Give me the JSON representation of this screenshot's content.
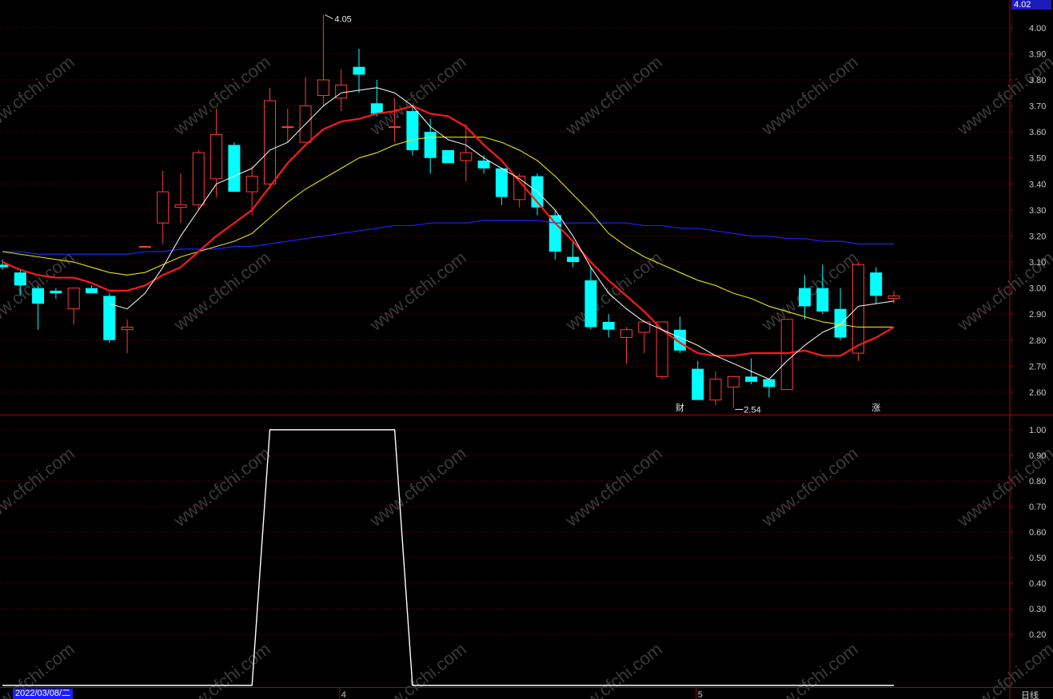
{
  "chart_data": {
    "type": "candlestick",
    "price_panel": {
      "ylim": [
        2.52,
        4.07
      ],
      "ticks": [
        4.0,
        3.9,
        3.8,
        3.7,
        3.6,
        3.5,
        3.4,
        3.3,
        3.2,
        3.1,
        3.0,
        2.9,
        2.8,
        2.7,
        2.6
      ],
      "tick_labels": [
        "4.00",
        "3.90",
        "3.80",
        "3.70",
        "3.60",
        "3.50",
        "3.40",
        "3.30",
        "3.20",
        "3.10",
        "3.00",
        "2.90",
        "2.80",
        "2.70",
        "2.60"
      ],
      "grid": true,
      "high_label": "4.05",
      "low_label": "2.54",
      "markers": [
        "财",
        "涨"
      ],
      "candles": [
        {
          "o": 3.09,
          "h": 3.11,
          "l": 3.07,
          "c": 3.08
        },
        {
          "o": 3.06,
          "h": 3.07,
          "l": 2.97,
          "c": 3.01
        },
        {
          "o": 3.0,
          "h": 3.01,
          "l": 2.84,
          "c": 2.94
        },
        {
          "o": 2.99,
          "h": 3.0,
          "l": 2.96,
          "c": 2.98
        },
        {
          "o": 2.92,
          "h": 3.0,
          "l": 2.86,
          "c": 3.0
        },
        {
          "o": 3.0,
          "h": 3.01,
          "l": 2.98,
          "c": 2.98
        },
        {
          "o": 2.97,
          "h": 2.98,
          "l": 2.79,
          "c": 2.8
        },
        {
          "o": 2.84,
          "h": 2.88,
          "l": 2.75,
          "c": 2.85
        },
        {
          "o": 3.16,
          "h": 3.16,
          "l": 3.16,
          "c": 3.16
        },
        {
          "o": 3.25,
          "h": 3.45,
          "l": 3.17,
          "c": 3.37
        },
        {
          "o": 3.31,
          "h": 3.44,
          "l": 3.25,
          "c": 3.32
        },
        {
          "o": 3.32,
          "h": 3.53,
          "l": 3.3,
          "c": 3.52
        },
        {
          "o": 3.42,
          "h": 3.69,
          "l": 3.35,
          "c": 3.59
        },
        {
          "o": 3.55,
          "h": 3.56,
          "l": 3.37,
          "c": 3.37
        },
        {
          "o": 3.37,
          "h": 3.47,
          "l": 3.28,
          "c": 3.43
        },
        {
          "o": 3.4,
          "h": 3.77,
          "l": 3.38,
          "c": 3.72
        },
        {
          "o": 3.62,
          "h": 3.69,
          "l": 3.56,
          "c": 3.62
        },
        {
          "o": 3.56,
          "h": 3.81,
          "l": 3.56,
          "c": 3.7
        },
        {
          "o": 3.74,
          "h": 4.05,
          "l": 3.7,
          "c": 3.8
        },
        {
          "o": 3.73,
          "h": 3.84,
          "l": 3.68,
          "c": 3.78
        },
        {
          "o": 3.85,
          "h": 3.92,
          "l": 3.75,
          "c": 3.82
        },
        {
          "o": 3.71,
          "h": 3.8,
          "l": 3.66,
          "c": 3.67
        },
        {
          "o": 3.62,
          "h": 3.73,
          "l": 3.56,
          "c": 3.62
        },
        {
          "o": 3.68,
          "h": 3.7,
          "l": 3.51,
          "c": 3.53
        },
        {
          "o": 3.6,
          "h": 3.65,
          "l": 3.44,
          "c": 3.5
        },
        {
          "o": 3.53,
          "h": 3.53,
          "l": 3.48,
          "c": 3.48
        },
        {
          "o": 3.49,
          "h": 3.63,
          "l": 3.41,
          "c": 3.52
        },
        {
          "o": 3.49,
          "h": 3.51,
          "l": 3.44,
          "c": 3.46
        },
        {
          "o": 3.46,
          "h": 3.46,
          "l": 3.32,
          "c": 3.35
        },
        {
          "o": 3.34,
          "h": 3.44,
          "l": 3.31,
          "c": 3.43
        },
        {
          "o": 3.43,
          "h": 3.44,
          "l": 3.28,
          "c": 3.31
        },
        {
          "o": 3.28,
          "h": 3.3,
          "l": 3.11,
          "c": 3.14
        },
        {
          "o": 3.12,
          "h": 3.18,
          "l": 3.08,
          "c": 3.1
        },
        {
          "o": 3.03,
          "h": 3.08,
          "l": 2.84,
          "c": 2.85
        },
        {
          "o": 2.87,
          "h": 2.9,
          "l": 2.81,
          "c": 2.84
        },
        {
          "o": 2.81,
          "h": 2.85,
          "l": 2.71,
          "c": 2.84
        },
        {
          "o": 2.83,
          "h": 2.88,
          "l": 2.75,
          "c": 2.87
        },
        {
          "o": 2.66,
          "h": 2.87,
          "l": 2.65,
          "c": 2.87
        },
        {
          "o": 2.84,
          "h": 2.89,
          "l": 2.75,
          "c": 2.76
        },
        {
          "o": 2.69,
          "h": 2.72,
          "l": 2.57,
          "c": 2.57
        },
        {
          "o": 2.57,
          "h": 2.68,
          "l": 2.55,
          "c": 2.65
        },
        {
          "o": 2.62,
          "h": 2.66,
          "l": 2.54,
          "c": 2.66
        },
        {
          "o": 2.66,
          "h": 2.73,
          "l": 2.63,
          "c": 2.64
        },
        {
          "o": 2.65,
          "h": 2.65,
          "l": 2.58,
          "c": 2.62
        },
        {
          "o": 2.61,
          "h": 2.88,
          "l": 2.61,
          "c": 2.88
        },
        {
          "o": 3.0,
          "h": 3.05,
          "l": 2.88,
          "c": 2.93
        },
        {
          "o": 3.0,
          "h": 3.09,
          "l": 2.9,
          "c": 2.91
        },
        {
          "o": 2.92,
          "h": 3.0,
          "l": 2.8,
          "c": 2.81
        },
        {
          "o": 2.75,
          "h": 3.1,
          "l": 2.72,
          "c": 3.09
        },
        {
          "o": 3.06,
          "h": 3.08,
          "l": 2.94,
          "c": 2.97
        },
        {
          "o": 2.96,
          "h": 2.99,
          "l": 2.94,
          "c": 2.97
        }
      ],
      "ma_white": [
        3.08,
        null,
        null,
        null,
        null,
        null,
        2.94,
        2.92,
        2.98,
        3.08,
        3.2,
        3.3,
        3.4,
        3.43,
        3.46,
        3.53,
        3.56,
        3.63,
        3.7,
        3.75,
        3.76,
        3.77,
        3.75,
        3.7,
        3.62,
        3.57,
        3.55,
        3.5,
        3.46,
        3.42,
        3.37,
        3.3,
        3.2,
        3.08,
        2.98,
        2.92,
        2.87,
        2.84,
        2.81,
        2.78,
        2.74,
        2.71,
        2.68,
        2.65,
        2.72,
        2.78,
        2.83,
        2.86,
        2.93,
        2.94,
        2.95
      ],
      "ma_red": [
        3.1,
        3.07,
        3.05,
        3.04,
        3.04,
        3.02,
        2.99,
        2.99,
        3.01,
        3.05,
        3.08,
        3.14,
        3.2,
        3.25,
        3.3,
        3.39,
        3.48,
        3.55,
        3.61,
        3.64,
        3.65,
        3.67,
        3.68,
        3.7,
        3.67,
        3.66,
        3.62,
        3.55,
        3.49,
        3.41,
        3.33,
        3.25,
        3.18,
        3.1,
        3.03,
        2.97,
        2.91,
        2.84,
        2.79,
        2.75,
        2.74,
        2.74,
        2.75,
        2.75,
        2.75,
        2.76,
        2.74,
        2.74,
        2.78,
        2.81,
        2.85
      ],
      "ma_yellow": [
        3.14,
        3.13,
        3.12,
        3.11,
        3.1,
        3.08,
        3.06,
        3.05,
        3.06,
        3.09,
        3.12,
        3.14,
        3.16,
        3.18,
        3.21,
        3.27,
        3.33,
        3.38,
        3.42,
        3.46,
        3.5,
        3.52,
        3.55,
        3.57,
        3.58,
        3.58,
        3.58,
        3.58,
        3.56,
        3.53,
        3.49,
        3.43,
        3.36,
        3.29,
        3.21,
        3.16,
        3.12,
        3.09,
        3.06,
        3.03,
        3.01,
        2.98,
        2.96,
        2.93,
        2.91,
        2.89,
        2.87,
        2.86,
        2.85,
        2.85,
        2.85
      ],
      "ma_blue": [
        3.14,
        3.14,
        3.13,
        3.13,
        3.13,
        3.13,
        3.13,
        3.13,
        3.14,
        3.14,
        3.15,
        3.15,
        3.15,
        3.16,
        3.16,
        3.17,
        3.18,
        3.19,
        3.2,
        3.21,
        3.22,
        3.23,
        3.24,
        3.24,
        3.25,
        3.25,
        3.25,
        3.26,
        3.26,
        3.26,
        3.26,
        3.25,
        3.25,
        3.25,
        3.25,
        3.25,
        3.24,
        3.24,
        3.23,
        3.23,
        3.22,
        3.21,
        3.2,
        3.2,
        3.19,
        3.19,
        3.18,
        3.18,
        3.17,
        3.17,
        3.17
      ]
    },
    "indicator_panel": {
      "ylim": [
        0.0,
        1.05
      ],
      "ticks": [
        1.0,
        0.9,
        0.8,
        0.7,
        0.6,
        0.5,
        0.4,
        0.3,
        0.2
      ],
      "tick_labels": [
        "1.00",
        "0.90",
        "0.80",
        "0.70",
        "0.60",
        "0.50",
        "0.40",
        "0.30",
        "0.20"
      ],
      "values": [
        0,
        0,
        0,
        0,
        0,
        0,
        0,
        0,
        0,
        0,
        0,
        0,
        0,
        0,
        0,
        1,
        1,
        1,
        1,
        1,
        1,
        1,
        1,
        0,
        0,
        0,
        0,
        0,
        0,
        0,
        0,
        0,
        0,
        0,
        0,
        0,
        0,
        0,
        0,
        0,
        0,
        0,
        0,
        0,
        0,
        0,
        0,
        0,
        0,
        0,
        0
      ]
    },
    "x_axis": {
      "start_date": "2022/03/08/二",
      "month_markers": [
        {
          "label": "4",
          "index": 19
        },
        {
          "label": "5",
          "index": 39
        }
      ]
    },
    "current_price": "4.02",
    "period": "日线"
  },
  "watermark": "www.cfchi.com",
  "colors": {
    "up": "#ff3b3b",
    "down": "#00ffff",
    "ma_white": "#ffffff",
    "ma_red": "#ff1a1a",
    "ma_yellow": "#e6e600",
    "ma_blue": "#2020ff",
    "grid": "#8b0000",
    "frame": "#b00000"
  }
}
